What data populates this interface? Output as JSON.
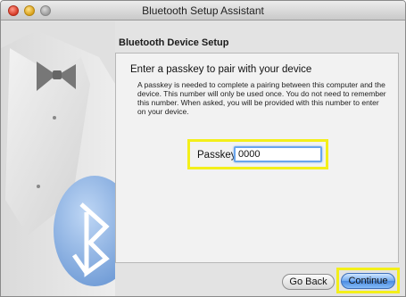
{
  "window": {
    "title": "Bluetooth Setup Assistant"
  },
  "section": {
    "title": "Bluetooth Device Setup"
  },
  "panel": {
    "heading": "Enter a passkey to pair with your device",
    "body": "A passkey is needed to complete a pairing between this computer and the device. This number will only be used once. You do not need to remember this number. When asked, you will be provided with this number to enter on your device.",
    "passkey_label": "Passkey:",
    "passkey_value": "0000"
  },
  "buttons": {
    "go_back": "Go Back",
    "continue": "Continue"
  },
  "icons": {
    "window_controls": [
      "close-icon",
      "minimize-icon",
      "zoom-icon"
    ],
    "artwork": "bluetooth-icon"
  },
  "colors": {
    "highlight": "#f3ef1a",
    "accent": "#4b8be1"
  }
}
